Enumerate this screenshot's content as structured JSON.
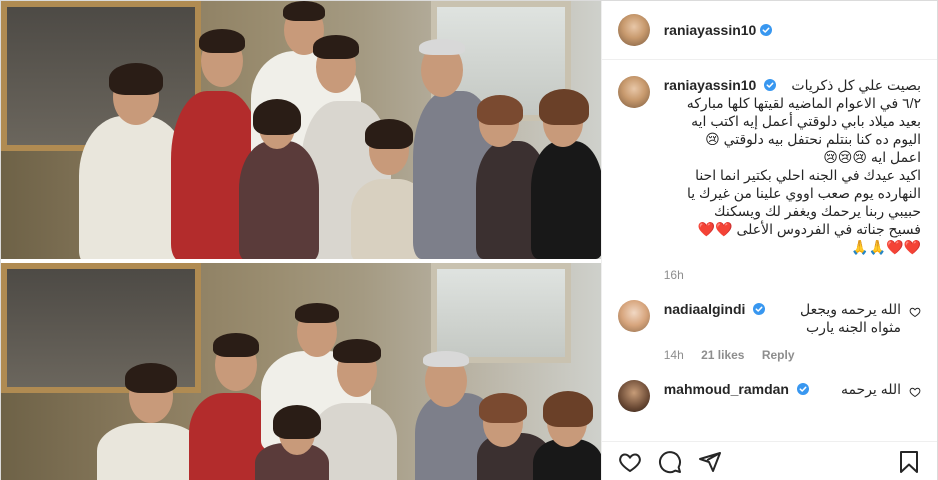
{
  "post": {
    "author": "raniayassin10",
    "caption_lines": [
      "بصيت علي كل ذكريات",
      "٦/٢ في الاعوام الماضيه لقيتها كلها مباركه",
      "بعيد ميلاد بابي دلوقتي أعمل إيه اكتب ايه",
      "اليوم ده كنا بنتلم نحتفل بيه دلوقتي 😢",
      "اعمل ايه 😢😢😢",
      "اكيد عيدك في الجنه احلي بكتير انما احنا",
      "النهارده يوم صعب اووي علينا من غيرك يا",
      "حبيبي ربنا يرحمك ويغفر لك ويسكنك",
      "فسيح جناته في الفردوس الأعلى ❤️❤️",
      "❤️❤️🙏🙏"
    ],
    "caption_time": "16h"
  },
  "comments": [
    {
      "user": "nadiaalgindi",
      "text_line1": "الله يرحمه ويجعل",
      "text_line2": "مثواه الجنه يارب",
      "time": "14h",
      "likes": "21 likes",
      "reply": "Reply"
    },
    {
      "user": "mahmoud_ramdan",
      "text_line1": "الله يرحمه"
    }
  ],
  "colors": {
    "verified": "#3897f0",
    "text": "#262626",
    "meta": "#8e8e8e",
    "border": "#dbdbdb"
  },
  "icons": {
    "like": "heart-icon",
    "comment": "comment-icon",
    "share": "paper-plane-icon",
    "save": "bookmark-icon",
    "verified": "verified-badge-icon"
  }
}
